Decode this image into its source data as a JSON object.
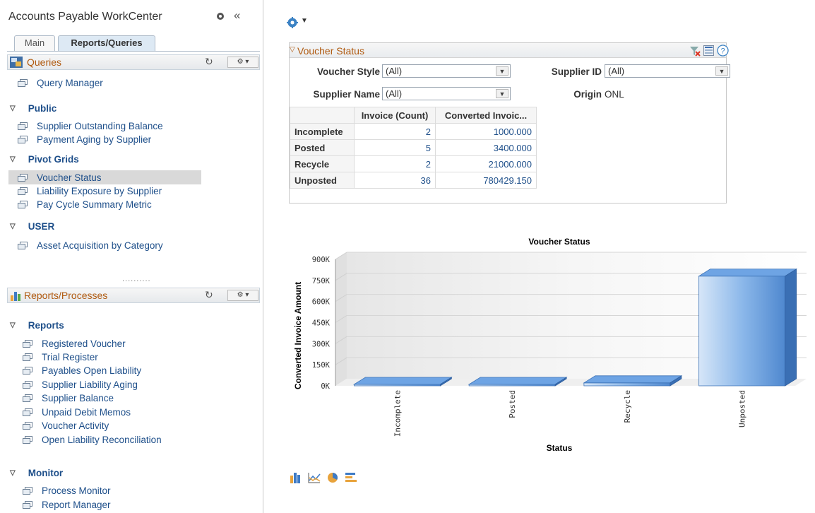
{
  "workcenter": {
    "title": "Accounts Payable WorkCenter",
    "collapse_glyph": "«",
    "tabs": [
      {
        "label": "Main"
      },
      {
        "label": "Reports/Queries"
      }
    ]
  },
  "queries_pagelet": {
    "title": "Queries",
    "top_item": "Query Manager",
    "groups": [
      {
        "label": "Public",
        "items": [
          "Supplier Outstanding Balance",
          "Payment Aging by Supplier"
        ]
      },
      {
        "label": "Pivot Grids",
        "items": [
          "Voucher Status",
          "Liability Exposure by Supplier",
          "Pay Cycle Summary Metric"
        ]
      },
      {
        "label": "USER",
        "items": [
          "Asset Acquisition by Category"
        ]
      }
    ],
    "selected_item": "Voucher Status"
  },
  "splitter": "..........",
  "reports_pagelet": {
    "title": "Reports/Processes",
    "groups": [
      {
        "label": "Reports",
        "items": [
          "Registered Voucher",
          "Trial Register",
          "Payables Open Liability",
          "Supplier Liability Aging",
          "Supplier Balance",
          "Unpaid Debit Memos",
          "Voucher Activity",
          "Open Liability Reconciliation"
        ]
      },
      {
        "label": "Monitor",
        "items": [
          "Process Monitor",
          "Report Manager"
        ]
      }
    ]
  },
  "voucher_status": {
    "title": "Voucher Status",
    "filters": {
      "voucher_style_label": "Voucher Style",
      "voucher_style_value": "(All)",
      "supplier_id_label": "Supplier ID",
      "supplier_id_value": "(All)",
      "supplier_name_label": "Supplier Name",
      "supplier_name_value": "(All)",
      "origin_label": "Origin",
      "origin_value": "ONL"
    },
    "table": {
      "columns": [
        "",
        "Invoice (Count)",
        "Converted Invoic..."
      ],
      "rows": [
        {
          "status": "Incomplete",
          "count": "2",
          "amount": "1000.000"
        },
        {
          "status": "Posted",
          "count": "5",
          "amount": "3400.000"
        },
        {
          "status": "Recycle",
          "count": "2",
          "amount": "21000.000"
        },
        {
          "status": "Unposted",
          "count": "36",
          "amount": "780429.150"
        }
      ]
    }
  },
  "icons": {
    "main_gear": "gear-icon",
    "filter_clear": "clear-filter-icon",
    "grid_view": "grid-view-icon",
    "help": "help-icon",
    "chart_types": [
      "bar-chart-icon",
      "line-chart-icon",
      "pie-chart-icon",
      "horizontal-bar-chart-icon"
    ]
  },
  "colors": {
    "accent": "#b05a10",
    "link": "#1e4f8a",
    "bar": "#5a93d8"
  },
  "chart_data": {
    "type": "bar",
    "title": "Voucher Status",
    "xlabel": "Status",
    "ylabel": "Converted Invoice Amount",
    "categories": [
      "Incomplete",
      "Posted",
      "Recycle",
      "Unposted"
    ],
    "values": [
      1000,
      3400,
      21000,
      780429.15
    ],
    "ylim": [
      0,
      900000
    ],
    "yticks": [
      0,
      150000,
      300000,
      450000,
      600000,
      750000,
      900000
    ],
    "ytick_labels": [
      "0K",
      "150K",
      "300K",
      "450K",
      "600K",
      "750K",
      "900K"
    ],
    "style": "3d",
    "grid": true
  }
}
